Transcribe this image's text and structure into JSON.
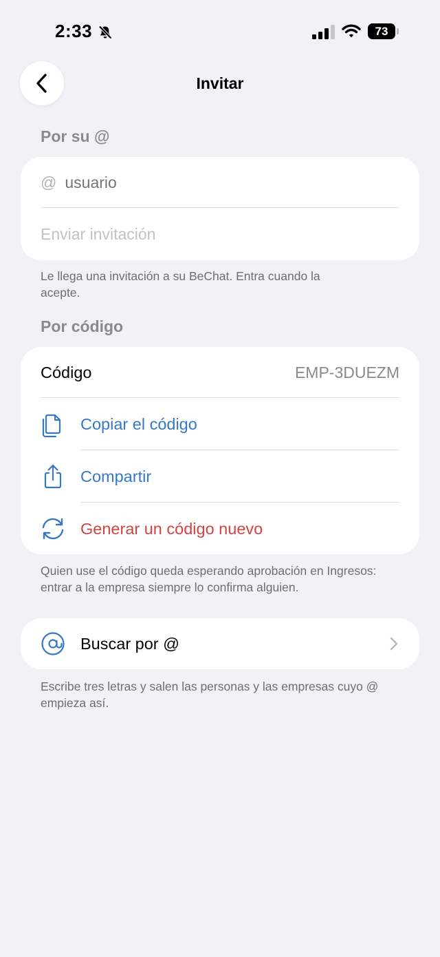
{
  "status_bar": {
    "time": "2:33",
    "battery": "73",
    "icons": [
      "bell-slash-icon",
      "cellular-signal-icon",
      "wifi-icon",
      "battery-icon"
    ]
  },
  "header": {
    "title": "Invitar",
    "back_icon": "chevron-left-icon"
  },
  "by_handle": {
    "section_label": "Por su @",
    "at_symbol": "@",
    "username_placeholder": "usuario",
    "send_placeholder": "Enviar invitación",
    "footnote": "Le llega una invitación a su BeChat. Entra cuando la acepte."
  },
  "by_code": {
    "section_label": "Por código",
    "code_label": "Código",
    "code_value": "EMP-3DUEZM",
    "actions": [
      {
        "label": "Copiar el código",
        "icon": "copy-icon",
        "color": "#3478c6"
      },
      {
        "label": "Compartir",
        "icon": "share-icon",
        "color": "#3478c6"
      },
      {
        "label": "Generar un código nuevo",
        "icon": "refresh-icon",
        "color": "#d0443f"
      }
    ],
    "footnote": "Quien use el código queda esperando aprobación en Ingresos: entrar a la empresa siempre lo confirma alguien."
  },
  "search": {
    "label": "Buscar por @",
    "icon": "at-sign-icon",
    "chevron": "chevron-right-icon",
    "footnote": "Escribe tres letras y salen las personas y las empresas cuyo @ empieza así."
  },
  "colors": {
    "background": "#f1f1f6",
    "card": "#ffffff",
    "accent": "#3478c6",
    "destructive": "#d0443f",
    "secondary_text": "#8a8a8e"
  }
}
